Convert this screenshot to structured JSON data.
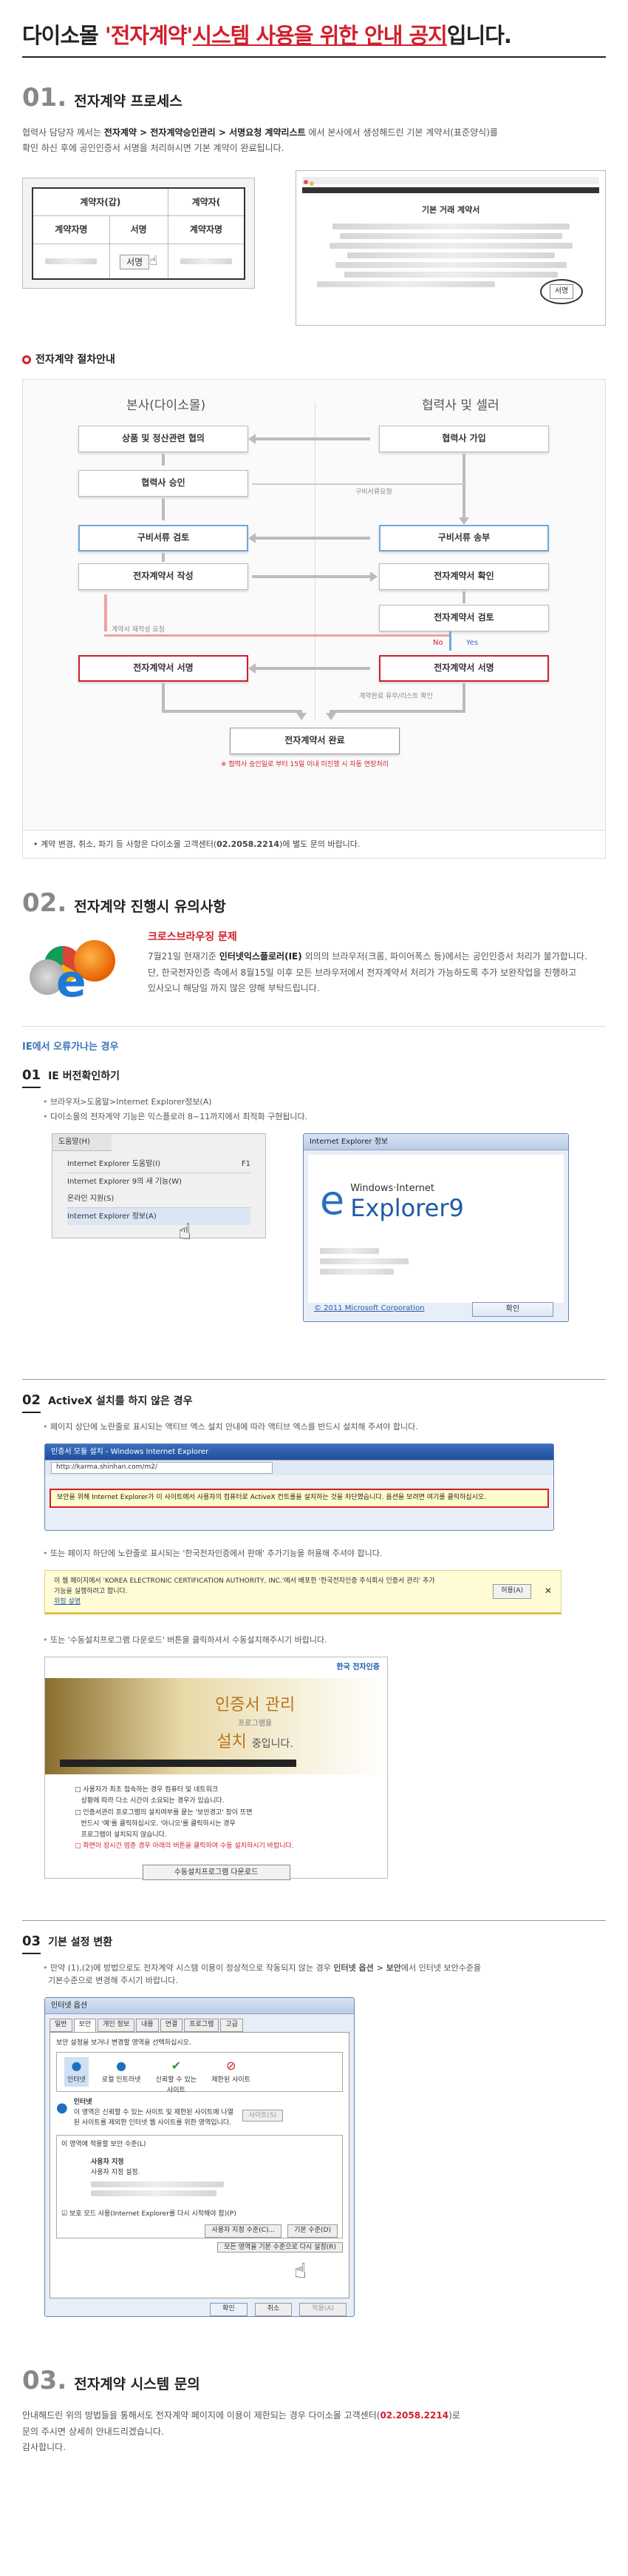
{
  "title": {
    "prefix": "다이소몰 ",
    "highlight": "'전자계약'",
    "highlight2": "시스템 사용을 위한 안내 공지",
    "suffix": "입니다."
  },
  "sec1": {
    "num": "01.",
    "heading": "전자계약 프로세스",
    "lead_1": "협력사 담당자 께서는 ",
    "lead_b1": "전자계약 > 전자계약승인관리 > 서명요청 계약리스트",
    "lead_2": " 에서 본사에서 생성해드린 기본 계약서(표준양식)를",
    "lead_3": "확인 하신 후에 공인인증서 서명을 처리하시면 기본 계약이 완료됩니다.",
    "tbl_header": "계약자(갑)",
    "tbl_header2": "계약자(",
    "col_a": "계약자명",
    "col_b": "서명",
    "col_c": "계약자명",
    "sign_btn": "서명",
    "doc_title": "기본 거래 계약서",
    "doc_sign": "서명"
  },
  "process": {
    "title": "전자계약 절차안내",
    "left_title": "본사(다이소몰)",
    "right_title": "협력사 및 셀러",
    "l1": "상품 및 정산관련 협의",
    "l2": "협력사 승인",
    "l3": "구비서류 검토",
    "l4": "전자계약서 작성",
    "l5": "전자계약서 서명",
    "r1": "협력사 가입",
    "r2": "구비서류 송부",
    "r3": "전자계약서 확인",
    "r4": "전자계약서 검토",
    "r5": "전자계약서 서명",
    "note_req": "구비서류요청",
    "note_fix": "계약서 재작성 요청",
    "note_return": "계약완료 유무/리스트 확인",
    "no": "No",
    "yes": "Yes",
    "done": "전자계약서 완료",
    "done_note": "※ 협력사 승인일로 부터 15일 이내 미진행 시 자동 연장처리",
    "notice_1": "• 계약 변경, 취소, 파기 등 사항은 다이소몰 고객센터(",
    "notice_tel": "02.2058.2214",
    "notice_2": ")에 별도 문의 바랍니다."
  },
  "sec2": {
    "num": "02.",
    "heading": "전자계약 진행시 유의사항",
    "cb_title": "크로스브라우징 문제",
    "cb_1": "7월21일 현재기준 ",
    "cb_b": "인터넷익스플로러(IE)",
    "cb_2": " 외의의 브라우저(크롬, 파이어폭스 등)에서는 공인인증서 처리가 불가합니다.",
    "cb_3": "단, 한국전자인증 측에서 8월15일 이후 모든 브라우저에서 전자계약서 처리가 가능하도록 추가 보완작업을 진행하고",
    "cb_4": "있사오니 해당일 까지 많은 양해 부탁드립니다.",
    "ie_err": "IE에서 오류가나는 경우",
    "s1_n": "01",
    "s1_t": "IE 버전확인하기",
    "s1_b1": "브라우저>도움말>Internet Explorer정보(A)",
    "s1_b2": "다이소몰의 전자계약 기능은 익스플로러 8~11까지에서 최적화 구현됩니다.",
    "menu_help": "도움말(H)",
    "menu_1": "Internet Explorer 도움말(I)",
    "menu_1_key": "F1",
    "menu_2": "Internet Explorer 9의 새 기능(W)",
    "menu_3": "온라인 지원(S)",
    "menu_4": "Internet Explorer 정보(A)",
    "about_title": "Internet Explorer 정보",
    "about_brand_1": "Windows",
    "about_brand_2": "Internet",
    "about_brand_3": "Explorer",
    "about_ver": "9",
    "about_copy": "© 2011 Microsoft Corporation",
    "about_ok": "확인",
    "s2_n": "02",
    "s2_t": "ActiveX 설치를 하지 않은 경우",
    "s2_b1": "페이지 상단에 노란줄로 표시되는 액티브 엑스 설치 안내에 따라 액티브 엑스를 반드시 설치해 주셔야 합니다.",
    "ie_title": "인증서 모듈 설치 - Windows Internet Explorer",
    "ie_url": "http://karma.shinhan.com/m2/",
    "ie_bar": "보안을 위해 Internet Explorer가 이 사이트에서 사용자의 컴퓨터로 ActiveX 컨트롤을 설치하는 것을 차단했습니다. 옵션을 보려면 여기를 클릭하십시오.",
    "s2_b2": "또는 페이지 하단에 노란줄로 표시되는 '한국전자인증에서 판매' 추가기능을 허용해 주셔야 합니다.",
    "bot_bar": "이 웹 페이지에서 'KOREA ELECTRONIC CERTIFICATION AUTHORITY, INC.'에서 배포한 '한국전자인증 주식회사 인증서 관리' 추가 기능을 실행하려고 합니다.",
    "bot_link": "위험 설명",
    "bot_btn": "허용(A)",
    "s2_b3": "또는 '수동설치프로그램 다운로드' 버튼을 클릭하셔서 수동설치해주시기 바랍니다.",
    "crt_logo": "한국 전자인증",
    "crt_1": "인증서 관리",
    "crt_2": "프로그램을",
    "crt_3": "설치",
    "crt_4": "중입니다.",
    "crt_l1": "사용자가 최초 접속하는 경우 컴퓨터 및 네트워크",
    "crt_l1b": "상황에 따라 다소 시간이 소요되는 경우가 있습니다.",
    "crt_l2": "인증서관리 프로그램의 설치여부를 묻는 '보안경고' 창이 뜨면",
    "crt_l2b": "반드시 '예'를 클릭하십시오. '아니오'를 클릭하시는 경우",
    "crt_l2c": "프로그램이 설치되지 않습니다.",
    "crt_l3": "화면이 장시간 멈춘 경우 아래의 버튼을 클릭하여 수동 설치하시기 바랍니다.",
    "crt_btn": "수동설치프로그램 다운로드",
    "s3_n": "03",
    "s3_t": "기본 설정 변환",
    "s3_b1_a": "만약 (1),(2)에 방법으로도 전자계약 시스템 이용이 정상적으로 작동되지 않는 경우 ",
    "s3_b1_b": "인터넷 옵션 > 보안",
    "s3_b1_c": "에서 인터넷 보안수준을",
    "s3_b1_d": "기본수준으로 변경해 주시기 바랍니다.",
    "opt_title": "인터넷 옵션",
    "opt_tabs": [
      "일반",
      "보안",
      "개인 정보",
      "내용",
      "연결",
      "프로그램",
      "고급"
    ],
    "opt_zone_lbl": "보안 설정을 보거나 변경할 영역을 선택하십시오.",
    "opt_zones": [
      "인터넷",
      "로컬 인트라넷",
      "신뢰할 수 있는 사이트",
      "제한된 사이트"
    ],
    "opt_inet": "인터넷",
    "opt_inet_d": "이 영역은 신뢰할 수 있는 사이트 및 제한된 사이트에 나열된 사이트를 제외한 인터넷 웹 사이트를 위한 영역입니다.",
    "opt_sites": "사이트(S)",
    "opt_level_lbl": "이 영역에 적용할 보안 수준(L)",
    "opt_custom": "사용자 지정",
    "opt_custom_d": "사용자 지정 설정.",
    "opt_protect": "보호 모드 사용(Internet Explorer를 다시 시작해야 함)(P)",
    "opt_btn1": "사용자 지정 수준(C)...",
    "opt_btn2": "기본 수준(D)",
    "opt_btn3": "모든 영역을 기본 수준으로 다시 설정(R)",
    "opt_ok": "확인",
    "opt_cancel": "취소",
    "opt_apply": "적용(A)"
  },
  "sec3": {
    "num": "03.",
    "heading": "전자계약 시스템 문의",
    "l1_a": "안내해드린 위의 방법들을 통해서도 전자계약 페이지에 이용이 제한되는 경우 다이소몰 고객센터(",
    "l1_tel": "02.2058.2214",
    "l1_b": ")로",
    "l2": "문의 주시면 상세히 안내드리겠습니다.",
    "l3": "감사합니다."
  }
}
